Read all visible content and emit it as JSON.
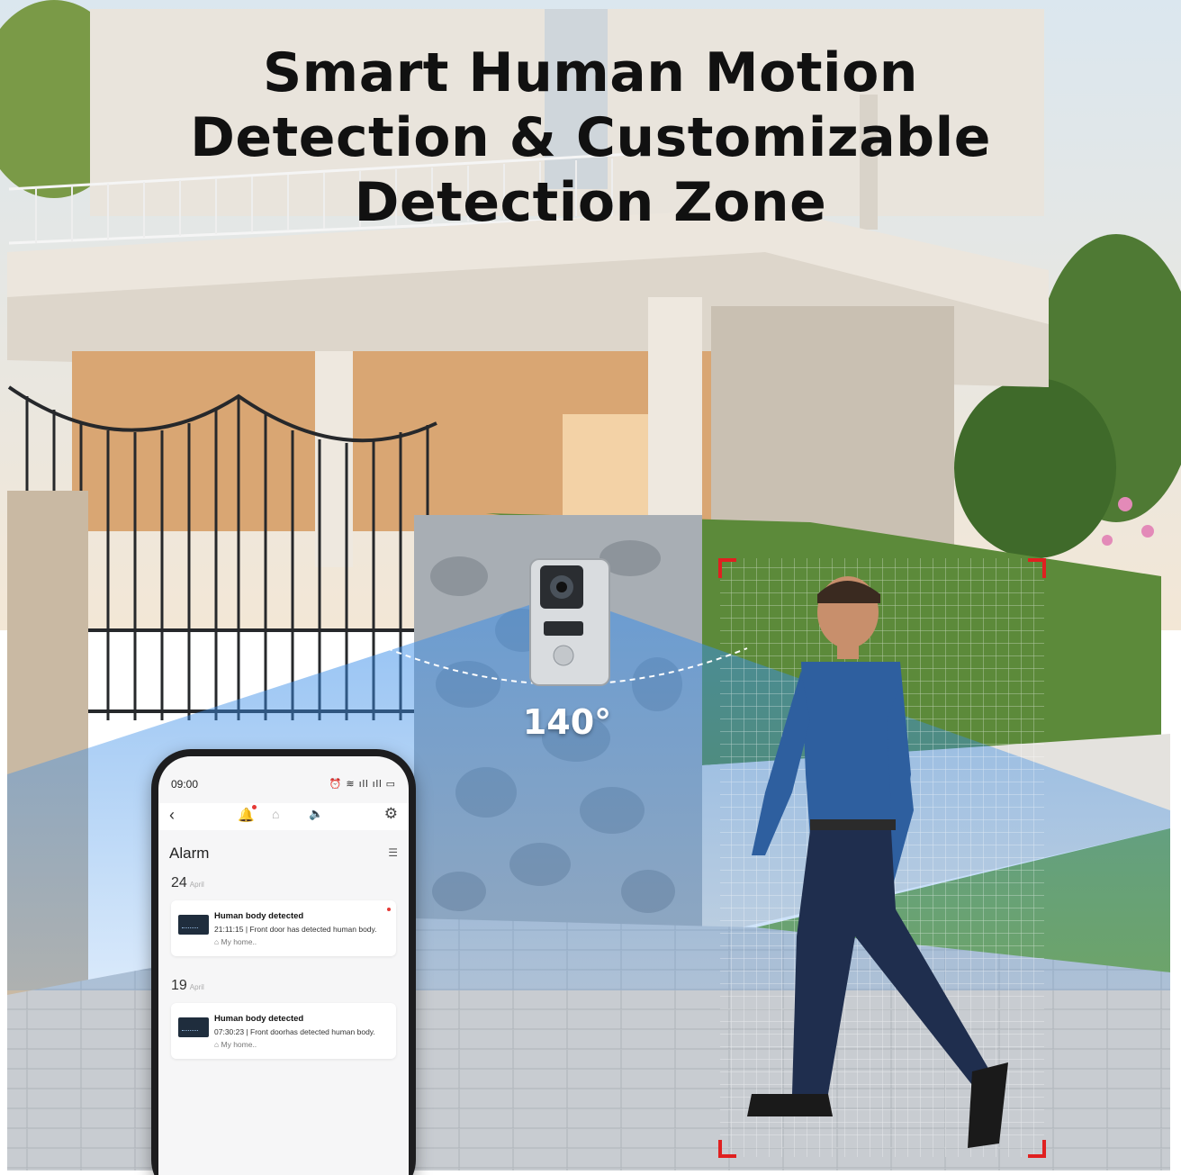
{
  "headline": {
    "line1": "Smart Human Motion",
    "line2": "Detection & Customizable",
    "line3": "Detection Zone"
  },
  "field_of_view": "140°",
  "phone": {
    "status": {
      "time": "09:00",
      "icons": "⏰ ≋ ıll ıll ▭"
    },
    "nav": {
      "back": "‹",
      "bell": "🔔",
      "home": "⌂",
      "speaker": "🔈",
      "settings": "⚙"
    },
    "alarm_title": "Alarm",
    "filter_icon": "☰",
    "groups": [
      {
        "day": "24",
        "month": "April",
        "alert": {
          "title": "Human body detected",
          "detail": "21:11:15 | Front door has detected human body.",
          "location": "⌂ My home.."
        }
      },
      {
        "day": "19",
        "month": "April",
        "alert": {
          "title": "Human body detected",
          "detail": "07:30:23 | Front doorhas detected human body.",
          "location": "⌂ My home.."
        }
      }
    ]
  },
  "colors": {
    "sky": "#cfe0ec",
    "wall": "#e9e4dc",
    "hedge": "#5c8a3a",
    "stone": "#9aa0a6",
    "paving": "#c9cdd2",
    "detection_blue": "#2f7fe0",
    "zone_marker": "#e02020",
    "bell_accent": "#f0552c"
  }
}
